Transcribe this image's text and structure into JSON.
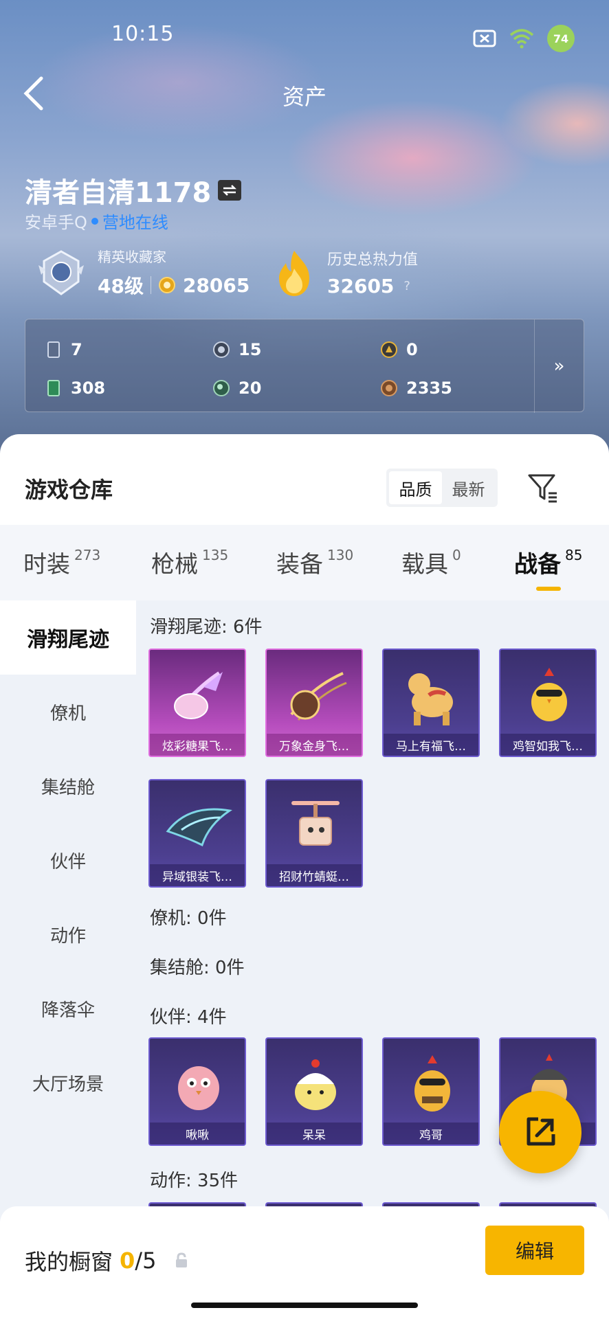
{
  "status_bar": {
    "time": "10:15",
    "battery": "74",
    "wifi_sub": "6"
  },
  "header": {
    "title": "资产"
  },
  "profile": {
    "name": "清者自清1178",
    "platform": "安卓手Q",
    "status": "营地在线",
    "rank_title": "精英收藏家",
    "level": "48级",
    "coins": "28065",
    "heat_title": "历史总热力值",
    "heat_value": "32605",
    "heat_help": "?"
  },
  "stats": [
    {
      "icon": "card-icon",
      "value": "7"
    },
    {
      "icon": "silver-coin-icon",
      "value": "15"
    },
    {
      "icon": "gold-badge-icon",
      "value": "0"
    },
    {
      "icon": "green-ticket-icon",
      "value": "308"
    },
    {
      "icon": "green-orb-icon",
      "value": "20"
    },
    {
      "icon": "bronze-coin-icon",
      "value": "2335"
    }
  ],
  "stats_more": "»",
  "warehouse": {
    "title": "游戏仓库",
    "sort_options": [
      "品质",
      "最新"
    ],
    "active_sort": 0
  },
  "tabs": [
    {
      "label": "时装",
      "count": "273"
    },
    {
      "label": "枪械",
      "count": "135"
    },
    {
      "label": "装备",
      "count": "130"
    },
    {
      "label": "载具",
      "count": "0"
    },
    {
      "label": "战备",
      "count": "85"
    }
  ],
  "active_tab": 4,
  "side_menu": [
    "滑翔尾迹",
    "僚机",
    "集结舱",
    "伙伴",
    "动作",
    "降落伞",
    "大厅场景"
  ],
  "sections": {
    "glide": {
      "title": "滑翔尾迹: 6件"
    },
    "wingman": {
      "title": "僚机: 0件"
    },
    "pod": {
      "title": "集结舱: 0件"
    },
    "partner": {
      "title": "伙伴: 4件"
    },
    "action": {
      "title": "动作: 35件"
    }
  },
  "glide_items": [
    "炫彩糖果飞…",
    "万象金身飞…",
    "马上有福飞…",
    "鸡智如我飞…",
    "异域银装飞…",
    "招财竹蜻蜓…"
  ],
  "partner_items": [
    "啾啾",
    "呆呆",
    "鸡哥",
    ""
  ],
  "bottom": {
    "label": "我的橱窗",
    "count_current": "0",
    "count_total": "/5",
    "edit": "编辑"
  },
  "colors": {
    "accent": "#f7b500",
    "online": "#2e8cff",
    "rare_purple": "#4c3f8f",
    "legend_pink": "#b64dbd"
  }
}
